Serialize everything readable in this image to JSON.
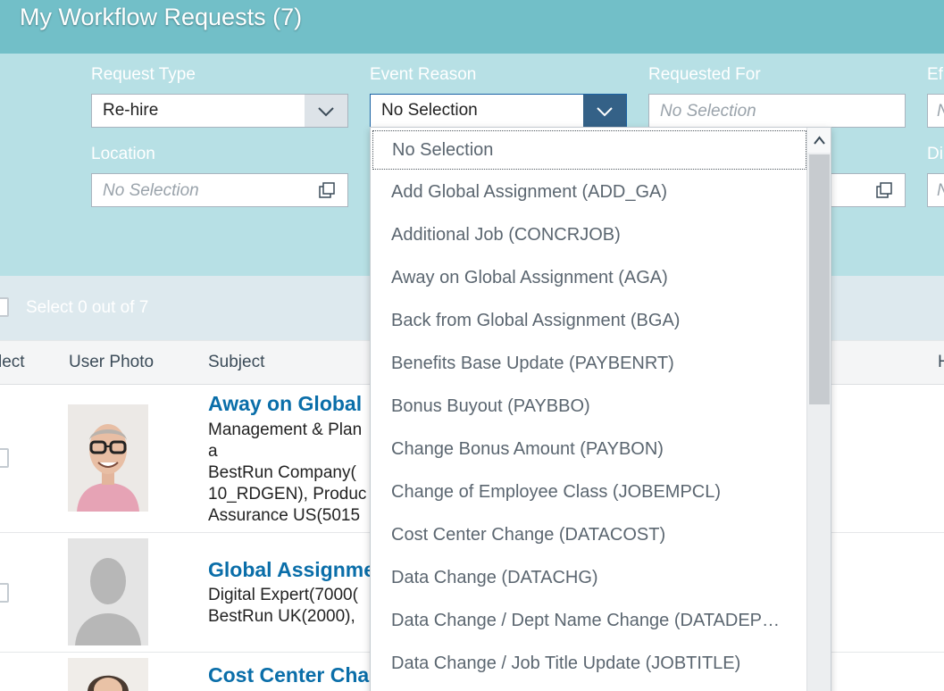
{
  "header": {
    "title": "My Workflow Requests (7)"
  },
  "filters": {
    "request_type": {
      "label": "Request Type",
      "value": "Re-hire"
    },
    "event_reason": {
      "label": "Event Reason",
      "value": "No Selection"
    },
    "requested_for": {
      "label": "Requested For",
      "placeholder": "No Selection"
    },
    "effective_partial": {
      "label": "Ef",
      "placeholder": "N"
    },
    "location": {
      "label": "Location",
      "placeholder": "No Selection"
    },
    "division_partial": {
      "label": "Di",
      "placeholder": "N"
    }
  },
  "toolbar": {
    "select_count": "Select 0 out of 7"
  },
  "table": {
    "columns": [
      "lect",
      "User Photo",
      "Subject",
      "H"
    ]
  },
  "rows": [
    {
      "subject": "Away on Global",
      "details": [
        "Management & Plan",
        "a",
        "BestRun Company(",
        "10_RDGEN), Produc",
        "Assurance US(5015"
      ]
    },
    {
      "subject": "Global Assignme",
      "details": [
        "Digital Expert(7000(",
        "BestRun UK(2000),"
      ]
    },
    {
      "subject": "Cost Center Cha",
      "details": []
    }
  ],
  "dropdown": {
    "options": [
      "No Selection",
      "Add Global Assignment (ADD_GA)",
      "Additional Job (CONCRJOB)",
      "Away on Global Assignment (AGA)",
      "Back from Global Assignment (BGA)",
      "Benefits Base Update (PAYBENRT)",
      "Bonus Buyout (PAYBBO)",
      "Change Bonus Amount (PAYBON)",
      "Change of Employee Class (JOBEMPCL)",
      "Cost Center Change (DATACOST)",
      "Data Change (DATACHG)",
      "Data Change / Dept Name Change (DATADEP…",
      "Data Change / Job Title Update (JOBTITLE)"
    ],
    "focused_index": 0
  },
  "colors": {
    "title_bar": "#72bfc8",
    "filter_bar": "#b7e0e5",
    "link": "#0a6ea9",
    "active_dropdown_button": "#346187"
  }
}
